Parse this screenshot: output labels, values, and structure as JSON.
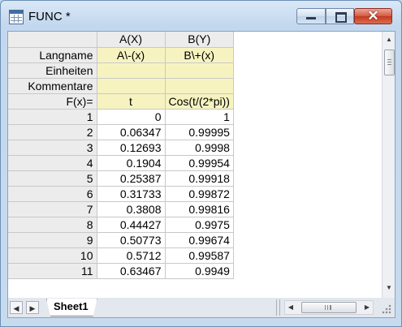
{
  "window": {
    "title": "FUNC *",
    "buttons": {
      "minimize": "minimize",
      "maximize": "maximize",
      "close": "✕"
    }
  },
  "columns": [
    {
      "header": "A(X)",
      "langname": "A\\-(x)",
      "einheiten": "",
      "kommentare": "",
      "fx": "t"
    },
    {
      "header": "B(Y)",
      "langname": "B\\+(x)",
      "einheiten": "",
      "kommentare": "",
      "fx": "Cos(t/(2*pi))"
    }
  ],
  "row_labels": {
    "langname": "Langname",
    "einheiten": "Einheiten",
    "kommentare": "Kommentare",
    "fx": "F(x)="
  },
  "rows": [
    {
      "n": "1",
      "a": "0",
      "b": "1"
    },
    {
      "n": "2",
      "a": "0.06347",
      "b": "0.99995"
    },
    {
      "n": "3",
      "a": "0.12693",
      "b": "0.9998"
    },
    {
      "n": "4",
      "a": "0.1904",
      "b": "0.99954"
    },
    {
      "n": "5",
      "a": "0.25387",
      "b": "0.99918"
    },
    {
      "n": "6",
      "a": "0.31733",
      "b": "0.99872"
    },
    {
      "n": "7",
      "a": "0.3808",
      "b": "0.99816"
    },
    {
      "n": "8",
      "a": "0.44427",
      "b": "0.9975"
    },
    {
      "n": "9",
      "a": "0.50773",
      "b": "0.99674"
    },
    {
      "n": "10",
      "a": "0.5712",
      "b": "0.99587"
    },
    {
      "n": "11",
      "a": "0.63467",
      "b": "0.9949"
    }
  ],
  "sheets": {
    "active": "Sheet1"
  },
  "colors": {
    "metadata_row_bg": "#f6f3c0",
    "header_bg": "#ececec",
    "close_button": "#d7583f"
  }
}
